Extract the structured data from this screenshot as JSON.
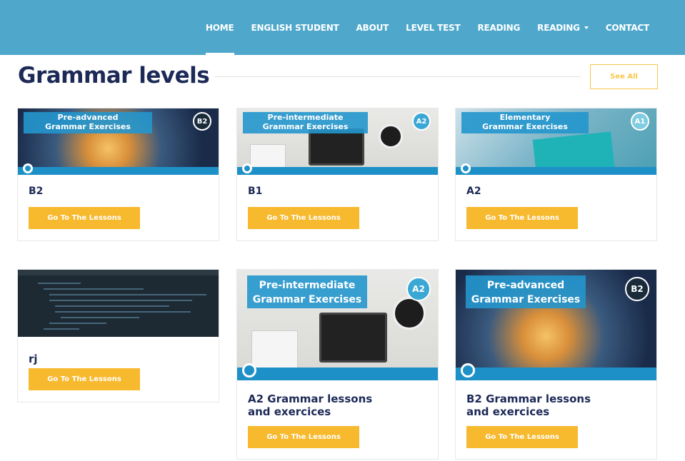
{
  "nav": {
    "items": [
      "HOME",
      "ENGLISH STUDENT",
      "ABOUT",
      "LEVEL TEST",
      "READING",
      "READING"
    ],
    "dropdown_item": "READING",
    "contact": "CONTACT",
    "active": "HOME"
  },
  "header": {
    "title": "Grammar levels",
    "see_all": "See All"
  },
  "cards": [
    {
      "title": "B2",
      "image": "pre-advanced-grammar-image",
      "banner": [
        "Pre-advanced",
        "Grammar Exercises"
      ],
      "badge": "B2",
      "button": "Go To The Lessons"
    },
    {
      "title": "B1",
      "image": "pre-intermediate-grammar-image",
      "banner": [
        "Pre-intermediate",
        "Grammar Exercises"
      ],
      "badge": "A2",
      "button": "Go To The Lessons"
    },
    {
      "title": "A2",
      "image": "elementary-grammar-image",
      "banner": [
        "Elementary",
        "Grammar Exercises"
      ],
      "badge": "A1",
      "button": "Go To The Lessons"
    },
    {
      "title": "rj",
      "image": "code-screenshot-image",
      "banner": [],
      "badge": "",
      "button": "Go To The Lessons"
    },
    {
      "title": "A2 Grammar lessons and exercices",
      "image": "pre-intermediate-grammar-image",
      "banner": [
        "Pre-intermediate",
        "Grammar Exercises"
      ],
      "badge": "A2",
      "button": "Go To The Lessons"
    },
    {
      "title": "B2 Grammar lessons and exercices",
      "image": "pre-advanced-grammar-image",
      "banner": [
        "Pre-advanced",
        "Grammar Exercises"
      ],
      "badge": "B2",
      "button": "Go To The Lessons"
    }
  ],
  "colors": {
    "nav_bg": "#4fa8cc",
    "title": "#1d2a57",
    "button": "#f7b92e",
    "see_all_border": "#f7c84c",
    "image_bar": "#1e90c8"
  }
}
